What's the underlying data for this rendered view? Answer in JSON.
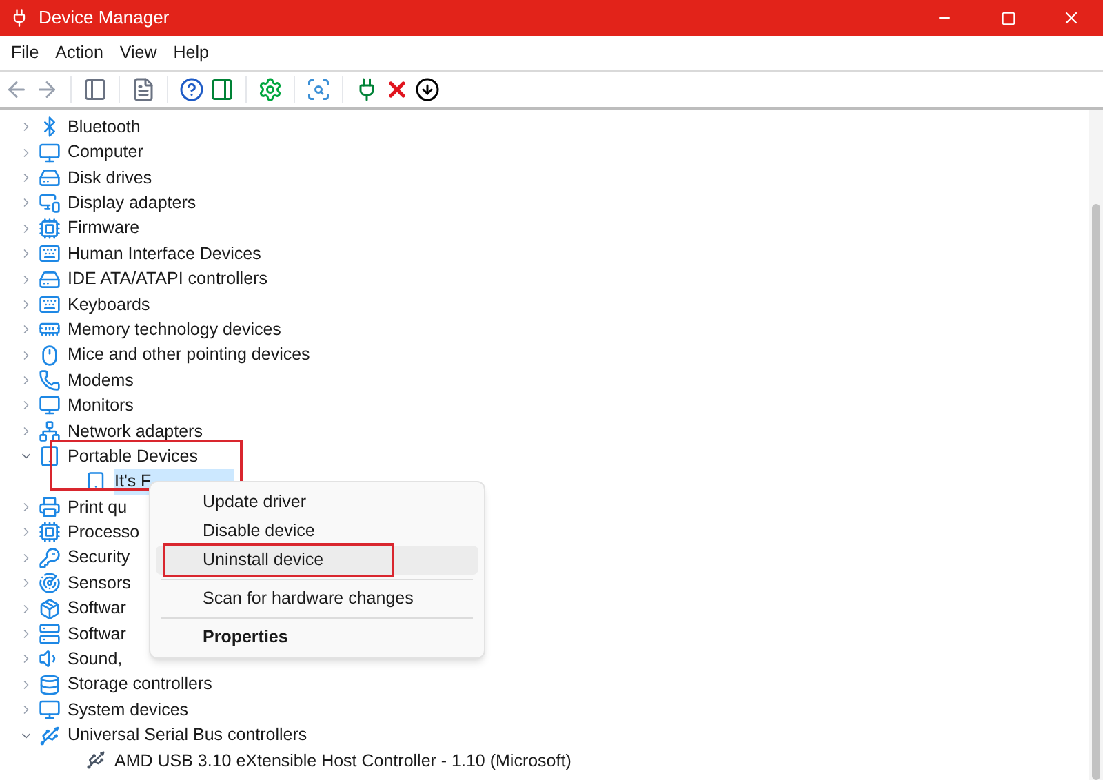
{
  "window": {
    "title": "Device Manager"
  },
  "menu": [
    "File",
    "Action",
    "View",
    "Help"
  ],
  "tree": [
    {
      "label": "Bluetooth",
      "expanded": false,
      "selected": false
    },
    {
      "label": "Computer",
      "expanded": false,
      "selected": false
    },
    {
      "label": "Disk drives",
      "expanded": false,
      "selected": false
    },
    {
      "label": "Display adapters",
      "expanded": false,
      "selected": false
    },
    {
      "label": "Firmware",
      "expanded": false,
      "selected": false
    },
    {
      "label": "Human Interface Devices",
      "expanded": false,
      "selected": false
    },
    {
      "label": "IDE ATA/ATAPI controllers",
      "expanded": false,
      "selected": false
    },
    {
      "label": "Keyboards",
      "expanded": false,
      "selected": false
    },
    {
      "label": "Memory technology devices",
      "expanded": false,
      "selected": false
    },
    {
      "label": "Mice and other pointing devices",
      "expanded": false,
      "selected": false
    },
    {
      "label": "Modems",
      "expanded": false,
      "selected": false
    },
    {
      "label": "Monitors",
      "expanded": false,
      "selected": false
    },
    {
      "label": "Network adapters",
      "expanded": false,
      "selected": false
    },
    {
      "label": "Portable Devices",
      "expanded": true,
      "selected": false,
      "annotated": true,
      "children": [
        {
          "label": "It's F",
          "selected": true
        }
      ]
    },
    {
      "label": "Print qu",
      "expanded": false,
      "selected": false
    },
    {
      "label": "Processo",
      "expanded": false,
      "selected": false
    },
    {
      "label": "Security",
      "expanded": false,
      "selected": false
    },
    {
      "label": "Sensors",
      "expanded": false,
      "selected": false
    },
    {
      "label": "Softwar",
      "expanded": false,
      "selected": false
    },
    {
      "label": "Softwar",
      "expanded": false,
      "selected": false
    },
    {
      "label": "Sound,",
      "expanded": false,
      "selected": false
    },
    {
      "label": "Storage controllers",
      "expanded": false,
      "selected": false
    },
    {
      "label": "System devices",
      "expanded": false,
      "selected": false
    },
    {
      "label": "Universal Serial Bus controllers",
      "expanded": true,
      "selected": false,
      "children": [
        {
          "label": "AMD USB 3.10 eXtensible Host Controller - 1.10 (Microsoft)",
          "selected": false
        }
      ]
    }
  ],
  "context_menu": [
    {
      "kind": "item",
      "label": "Update driver",
      "highlighted": false,
      "annotated": false
    },
    {
      "kind": "item",
      "label": "Disable device",
      "highlighted": false,
      "annotated": false
    },
    {
      "kind": "item",
      "label": "Uninstall device",
      "highlighted": true,
      "annotated": true
    },
    {
      "kind": "separator"
    },
    {
      "kind": "item",
      "label": "Scan for hardware changes",
      "highlighted": false,
      "annotated": false
    },
    {
      "kind": "separator"
    },
    {
      "kind": "bold",
      "label": "Properties",
      "highlighted": false,
      "annotated": false
    }
  ]
}
